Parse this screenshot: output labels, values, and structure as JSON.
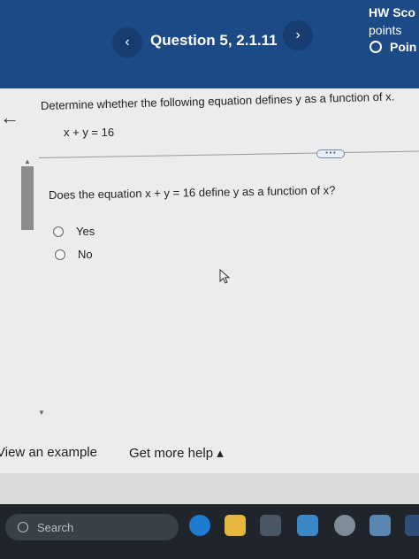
{
  "header": {
    "prev_label": "‹",
    "next_label": "›",
    "question_title": "Question 5, 2.1.11",
    "hw_score_label": "HW Sco",
    "points_label": "points",
    "points_row_label": "Poin"
  },
  "problem": {
    "prompt": "Determine whether the following equation defines y as a function of x.",
    "equation": "x + y = 16",
    "handle_label": "• • •",
    "question": "Does the equation x + y = 16 define y as a function of x?",
    "options": [
      {
        "label": "Yes",
        "selected": false
      },
      {
        "label": "No",
        "selected": false
      }
    ]
  },
  "footer": {
    "view_example": "View an example",
    "get_more_help": "Get more help ▴"
  },
  "taskbar": {
    "search_placeholder": "Search",
    "icons": [
      "edge-icon",
      "file-explorer-icon",
      "store-icon",
      "mail-icon",
      "settings-icon",
      "photos-icon",
      "app-icon"
    ]
  },
  "colors": {
    "header_bg": "#1c4a86",
    "taskbar_bg": "#1f252b"
  }
}
